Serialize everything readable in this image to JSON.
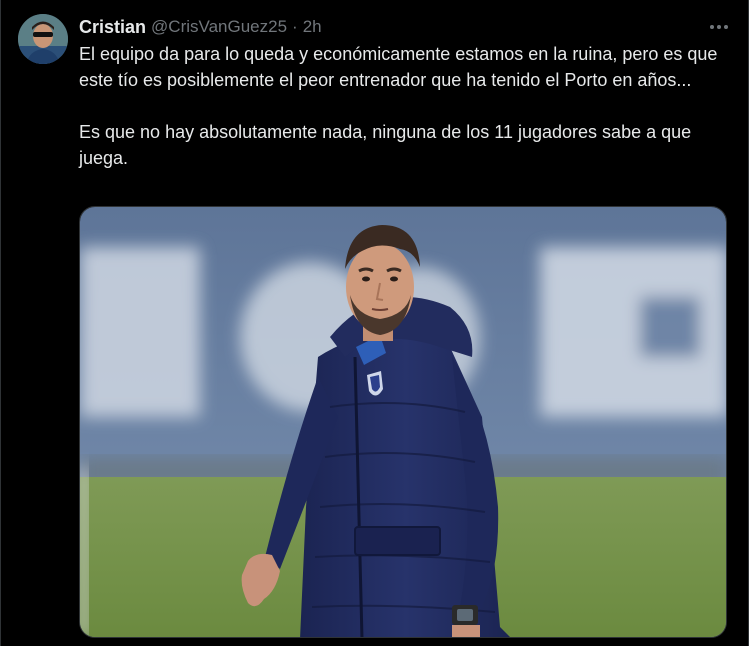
{
  "tweet": {
    "author": {
      "display_name": "Cristian",
      "handle": "@CrisVanGuez25"
    },
    "separator": "·",
    "timestamp": "2h",
    "more_icon": "more-horizontal-icon",
    "text": {
      "paragraph_1": "El equipo da para lo queda y económicamente estamos en la ruina, pero es que este tío es posiblemente el peor entrenador que ha tenido el Porto en años...",
      "paragraph_2": "Es que no hay absolutamente nada, ninguna de los 11 jugadores sabe a que juega."
    },
    "media": {
      "type": "photo"
    }
  },
  "colors": {
    "background": "#000000",
    "primary_text": "#e7e9ea",
    "secondary_text": "#71767b",
    "border": "#2f3336"
  }
}
